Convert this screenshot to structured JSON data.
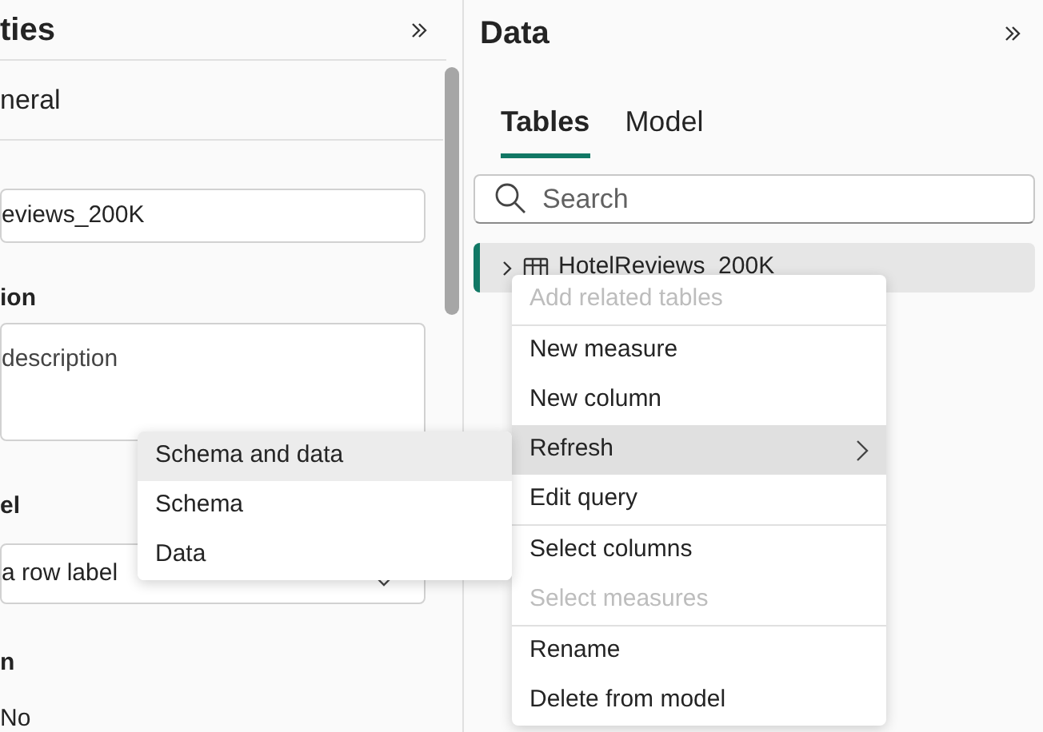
{
  "properties_panel": {
    "title": "ties",
    "section": "neral",
    "name_value": "eviews_200K",
    "description_label": "ion",
    "description_placeholder": "description",
    "row_label_label": "el",
    "row_label_value": "a row label",
    "label_4": "n",
    "value_4": "No"
  },
  "data_panel": {
    "title": "Data",
    "tabs": [
      {
        "label": "Tables",
        "selected": true
      },
      {
        "label": "Model",
        "selected": false
      }
    ],
    "search": {
      "placeholder": "Search"
    },
    "tables": [
      {
        "name": "HotelReviews_200K",
        "selected": true
      }
    ]
  },
  "context_menu": [
    {
      "label": "Add related tables",
      "disabled": true,
      "highlighted": false,
      "submenu": false,
      "divider_after": true
    },
    {
      "label": "New measure",
      "disabled": false,
      "highlighted": false,
      "submenu": false,
      "divider_after": false
    },
    {
      "label": "New column",
      "disabled": false,
      "highlighted": false,
      "submenu": false,
      "divider_after": false
    },
    {
      "label": "Refresh",
      "disabled": false,
      "highlighted": true,
      "submenu": true,
      "divider_after": false
    },
    {
      "label": "Edit query",
      "disabled": false,
      "highlighted": false,
      "submenu": false,
      "divider_after": true
    },
    {
      "label": "Select columns",
      "disabled": false,
      "highlighted": false,
      "submenu": false,
      "divider_after": false
    },
    {
      "label": "Select measures",
      "disabled": true,
      "highlighted": false,
      "submenu": false,
      "divider_after": true
    },
    {
      "label": "Rename",
      "disabled": false,
      "highlighted": false,
      "submenu": false,
      "divider_after": false
    },
    {
      "label": "Delete from model",
      "disabled": false,
      "highlighted": false,
      "submenu": false,
      "divider_after": false
    }
  ],
  "submenu": [
    {
      "label": "Schema and data",
      "highlighted": true
    },
    {
      "label": "Schema",
      "highlighted": false
    },
    {
      "label": "Data",
      "highlighted": false
    }
  ]
}
